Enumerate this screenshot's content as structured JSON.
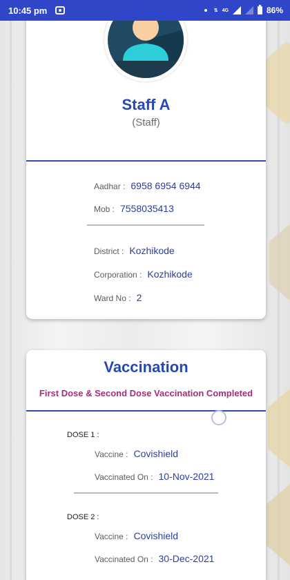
{
  "status_bar": {
    "time": "10:45 pm",
    "network_label": "4G",
    "battery": "86%"
  },
  "profile": {
    "name": "Staff A",
    "role": "(Staff)",
    "aadhar_label": "Aadhar :",
    "aadhar_value": "6958 6954 6944",
    "mob_label": "Mob :",
    "mob_value": "7558035413",
    "district_label": "District :",
    "district_value": "Kozhikode",
    "corporation_label": "Corporation :",
    "corporation_value": "Kozhikode",
    "ward_label": "Ward No :",
    "ward_value": "2"
  },
  "vaccination": {
    "title": "Vaccination",
    "status": "First Dose & Second Dose Vaccination Completed",
    "doses": [
      {
        "heading": "DOSE 1 :",
        "vaccine_label": "Vaccine :",
        "vaccine_value": "Covishield",
        "date_label": "Vaccinated On :",
        "date_value": "10-Nov-2021"
      },
      {
        "heading": "DOSE 2 :",
        "vaccine_label": "Vaccine :",
        "vaccine_value": "Covishield",
        "date_label": "Vaccinated On :",
        "date_value": "30-Dec-2021"
      }
    ]
  },
  "colors": {
    "status_bar": "#2f46c8",
    "accent_blue": "#2747b3",
    "status_magenta": "#a82c7a",
    "value_blue": "#2a3fa0"
  },
  "icons": [
    "screen-record-icon",
    "data-arrows-icon",
    "signal-icon",
    "battery-icon",
    "avatar-icon"
  ]
}
